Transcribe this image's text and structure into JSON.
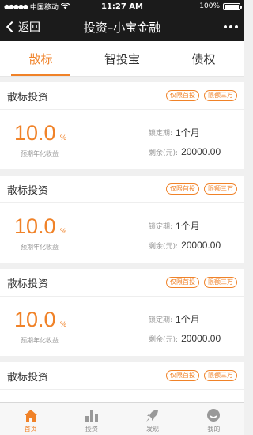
{
  "status_bar": {
    "carrier": "中国移动",
    "time": "11:27 AM",
    "battery": "100%"
  },
  "nav": {
    "back_label": "返回",
    "title": "投资–小宝金融"
  },
  "tabs": [
    {
      "label": "散标",
      "active": true
    },
    {
      "label": "智投宝",
      "active": false
    },
    {
      "label": "债权",
      "active": false
    }
  ],
  "cards": [
    {
      "title": "散标投资",
      "tags": [
        "仅限首投",
        "限额三万"
      ],
      "rate": "10.0",
      "rate_unit": "%",
      "rate_label": "预期年化收益",
      "lock_label": "锁定期:",
      "lock_value": "1个月",
      "remain_label": "剩余(元):",
      "remain_value": "20000.00"
    },
    {
      "title": "散标投资",
      "tags": [
        "仅限首投",
        "限额三万"
      ],
      "rate": "10.0",
      "rate_unit": "%",
      "rate_label": "预期年化收益",
      "lock_label": "锁定期:",
      "lock_value": "1个月",
      "remain_label": "剩余(元):",
      "remain_value": "20000.00"
    },
    {
      "title": "散标投资",
      "tags": [
        "仅限首投",
        "限额三万"
      ],
      "rate": "10.0",
      "rate_unit": "%",
      "rate_label": "预期年化收益",
      "lock_label": "锁定期:",
      "lock_value": "1个月",
      "remain_label": "剩余(元):",
      "remain_value": "20000.00"
    },
    {
      "title": "散标投资",
      "tags": [
        "仅限首投",
        "限额三万"
      ]
    }
  ],
  "tabbar": [
    {
      "label": "首页",
      "icon": "home-icon",
      "active": true
    },
    {
      "label": "投资",
      "icon": "bar-chart-icon",
      "active": false
    },
    {
      "label": "发现",
      "icon": "rocket-icon",
      "active": false
    },
    {
      "label": "我的",
      "icon": "profile-icon",
      "active": false
    }
  ],
  "colors": {
    "accent": "#f08228",
    "nav_bg": "#1b1b1b",
    "page_bg": "#f0f0f0"
  }
}
